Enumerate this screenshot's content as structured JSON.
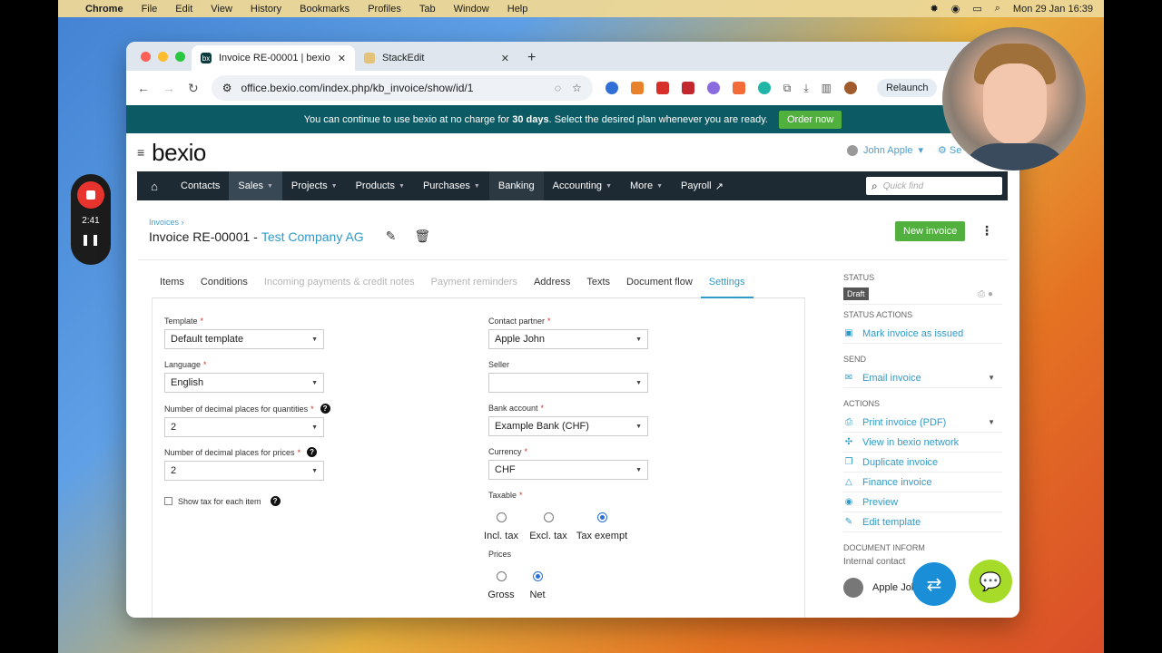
{
  "menubar": {
    "app": "Chrome",
    "items": [
      "File",
      "Edit",
      "View",
      "History",
      "Bookmarks",
      "Profiles",
      "Tab",
      "Window",
      "Help"
    ],
    "clock": "Mon 29 Jan  16:39"
  },
  "recorder": {
    "time": "2:41"
  },
  "browser": {
    "tabs": [
      {
        "title": "Invoice RE-00001 | bexio",
        "favicon": "bx"
      },
      {
        "title": "StackEdit"
      }
    ],
    "url": "office.bexio.com/index.php/kb_invoice/show/id/1",
    "relaunch": "Relaunch"
  },
  "banner": {
    "pre": "You can continue to use bexio at no charge for",
    "days": "30 days",
    "post": ". Select the desired plan whenever you are ready.",
    "button": "Order now"
  },
  "header": {
    "logo": "bexio",
    "user": "John Apple",
    "settings": "Se"
  },
  "nav": {
    "items": [
      {
        "label": "Contacts",
        "caret": false
      },
      {
        "label": "Sales",
        "caret": true
      },
      {
        "label": "Projects",
        "caret": true
      },
      {
        "label": "Products",
        "caret": true
      },
      {
        "label": "Purchases",
        "caret": true
      },
      {
        "label": "Banking",
        "caret": false
      },
      {
        "label": "Accounting",
        "caret": true
      },
      {
        "label": "More",
        "caret": true
      },
      {
        "label": "Payroll",
        "caret": false
      }
    ],
    "quickfind_placeholder": "Quick find"
  },
  "page": {
    "breadcrumb": "Invoices",
    "title": "Invoice RE-00001 -",
    "company": "Test Company AG",
    "new_invoice": "New invoice"
  },
  "tabs": [
    "Items",
    "Conditions",
    "Incoming payments & credit notes",
    "Payment reminders",
    "Address",
    "Texts",
    "Document flow",
    "Settings"
  ],
  "form": {
    "template_label": "Template",
    "template_value": "Default template",
    "language_label": "Language",
    "language_value": "English",
    "dec_qty_label": "Number of decimal places for quantities",
    "dec_qty_value": "2",
    "dec_price_label": "Number of decimal places for prices",
    "dec_price_value": "2",
    "show_tax_label": "Show tax for each item",
    "contact_label": "Contact partner",
    "contact_value": "Apple John",
    "seller_label": "Seller",
    "seller_value": "",
    "bank_label": "Bank account",
    "bank_value": "Example Bank (CHF)",
    "currency_label": "Currency",
    "currency_value": "CHF",
    "taxable_label": "Taxable",
    "taxable_options": [
      "Incl. tax",
      "Excl. tax",
      "Tax exempt"
    ],
    "taxable_selected": "Tax exempt",
    "prices_label": "Prices",
    "prices_options": [
      "Gross",
      "Net"
    ],
    "prices_selected": "Net"
  },
  "sidebar": {
    "status_h": "STATUS",
    "status": "Draft",
    "status_actions_h": "STATUS ACTIONS",
    "mark_issued": "Mark invoice as issued",
    "send_h": "SEND",
    "email": "Email invoice",
    "actions_h": "ACTIONS",
    "actions": [
      "Print invoice (PDF)",
      "View in bexio network",
      "Duplicate invoice",
      "Finance invoice",
      "Preview",
      "Edit template"
    ],
    "doc_info_h": "DOCUMENT INFORM",
    "internal_contact": "Internal contact",
    "contact_name": "Apple John"
  }
}
